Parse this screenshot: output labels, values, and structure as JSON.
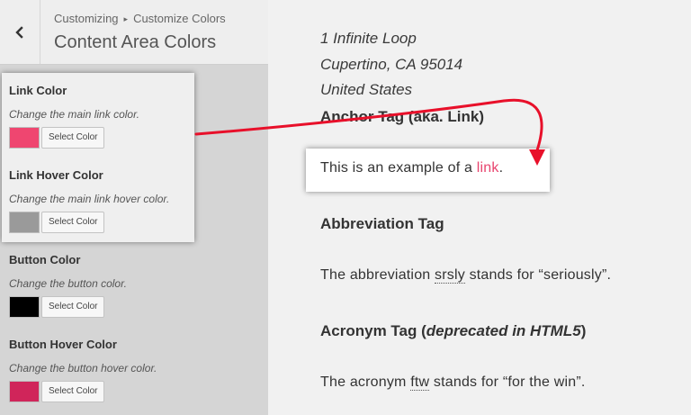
{
  "sidebar": {
    "breadcrumb": {
      "parent": "Customizing",
      "current": "Customize Colors"
    },
    "title": "Content Area Colors",
    "controls": [
      {
        "title": "Link Color",
        "description": "Change the main link color.",
        "color": "#ef4670",
        "button": "Select Color"
      },
      {
        "title": "Link Hover Color",
        "description": "Change the main link hover color.",
        "color": "#9a9a9a",
        "button": "Select Color"
      },
      {
        "title": "Button Color",
        "description": "Change the button color.",
        "color": "#000000",
        "button": "Select Color"
      },
      {
        "title": "Button Hover Color",
        "description": "Change the button hover color.",
        "color": "#d0255a",
        "button": "Select Color"
      }
    ]
  },
  "preview": {
    "address": [
      "1 Infinite Loop",
      "Cupertino, CA 95014",
      "United States"
    ],
    "anchor_heading": "Anchor Tag (aka. Link)",
    "link_sentence": {
      "before": "This is an example of a ",
      "link": "link",
      "after": "."
    },
    "abbr_heading": "Abbreviation Tag",
    "abbr_sentence": {
      "before": "The abbreviation ",
      "term": "srsly",
      "after": " stands for “seriously”."
    },
    "acronym_heading": {
      "before": "Acronym Tag (",
      "emphasis": "deprecated in HTML5",
      "after": ")"
    },
    "acronym_sentence": {
      "before": "The acronym ",
      "term": "ftw",
      "after": " stands for “for the win”."
    }
  },
  "colors": {
    "arrow": "#e8102a",
    "link": "#e8446e"
  }
}
